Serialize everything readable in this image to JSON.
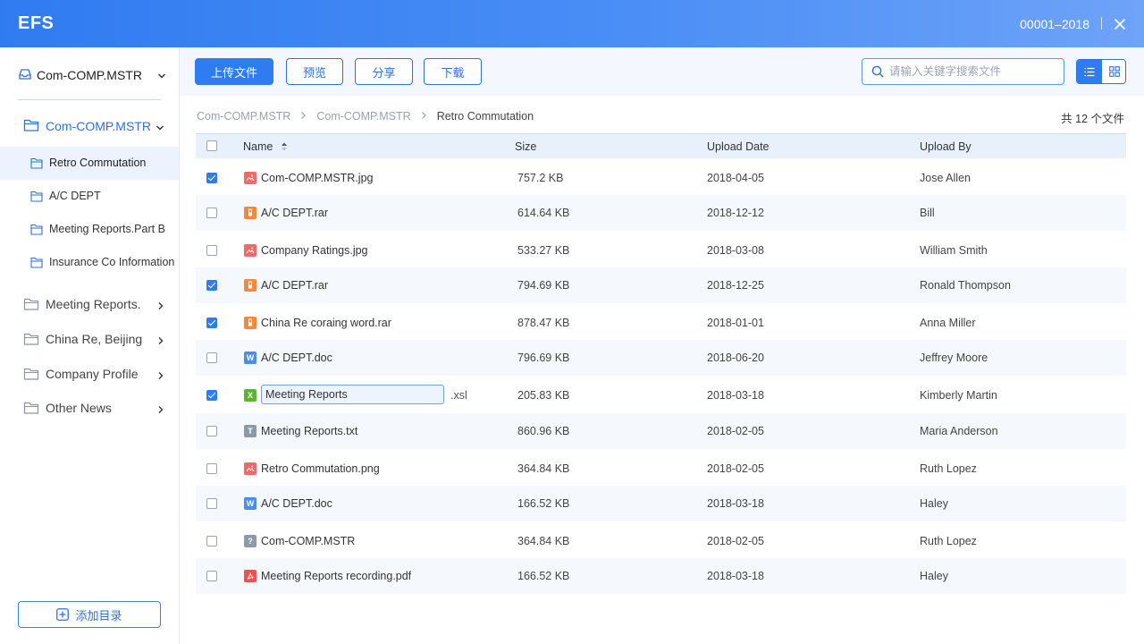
{
  "header": {
    "logo": "EFS",
    "code": "00001–2018"
  },
  "sidebar": {
    "library": "Com-COMP.MSTR",
    "tree_root": "Com-COMP.MSTR",
    "sub_items": [
      {
        "label": "Retro Commutation",
        "active": true
      },
      {
        "label": "A/C DEPT",
        "active": false
      },
      {
        "label": "Meeting Reports.Part B",
        "active": false
      },
      {
        "label": "Insurance Co Information",
        "active": false
      }
    ],
    "folders": [
      {
        "label": "Meeting Reports."
      },
      {
        "label": "China Re, Beijing"
      },
      {
        "label": "Company Profile"
      },
      {
        "label": "Other News"
      }
    ],
    "add_dir_label": "添加目录"
  },
  "toolbar": {
    "upload": "上传文件",
    "preview": "预览",
    "share": "分享",
    "download": "下载",
    "search_placeholder": "请输入关键字搜索文件"
  },
  "breadcrumb": [
    "Com-COMP.MSTR",
    "Com-COMP.MSTR",
    "Retro Commutation"
  ],
  "file_count": "共 12 个文件",
  "table": {
    "columns": {
      "name": "Name",
      "size": "Size",
      "date": "Upload Date",
      "by": "Upload By"
    },
    "rows": [
      {
        "checked": true,
        "type": "image",
        "name": "Com-COMP.MSTR.jpg",
        "size": "757.2 KB",
        "date": "2018-04-05",
        "by": "Jose Allen"
      },
      {
        "checked": false,
        "type": "archive",
        "name": "A/C DEPT.rar",
        "size": "614.64 KB",
        "date": "2018-12-12",
        "by": "Bill"
      },
      {
        "checked": false,
        "type": "image",
        "name": "Company Ratings.jpg",
        "size": "533.27 KB",
        "date": "2018-03-08",
        "by": "William Smith"
      },
      {
        "checked": true,
        "type": "archive",
        "name": "A/C DEPT.rar",
        "size": "794.69 KB",
        "date": "2018-12-25",
        "by": "Ronald Thompson"
      },
      {
        "checked": true,
        "type": "archive",
        "name": "China Re coraing word.rar",
        "size": "878.47 KB",
        "date": "2018-01-01",
        "by": "Anna Miller"
      },
      {
        "checked": false,
        "type": "word",
        "name": "A/C DEPT.doc",
        "size": "796.69 KB",
        "date": "2018-06-20",
        "by": "Jeffrey Moore"
      },
      {
        "checked": true,
        "type": "excel",
        "name": "Meeting Reports",
        "ext": ".xsl",
        "editing": true,
        "size": "205.83 KB",
        "date": "2018-03-18",
        "by": "Kimberly Martin"
      },
      {
        "checked": false,
        "type": "text",
        "name": "Meeting Reports.txt",
        "size": "860.96 KB",
        "date": "2018-02-05",
        "by": "Maria Anderson"
      },
      {
        "checked": false,
        "type": "image",
        "name": "Retro Commutation.png",
        "size": "364.84 KB",
        "date": "2018-02-05",
        "by": "Ruth Lopez"
      },
      {
        "checked": false,
        "type": "word",
        "name": "A/C DEPT.doc",
        "size": "166.52 KB",
        "date": "2018-03-18",
        "by": "Haley"
      },
      {
        "checked": false,
        "type": "unknown",
        "name": "Com-COMP.MSTR",
        "size": "364.84 KB",
        "date": "2018-02-05",
        "by": "Ruth Lopez"
      },
      {
        "checked": false,
        "type": "pdf",
        "name": "Meeting Reports recording.pdf",
        "size": "166.52 KB",
        "date": "2018-03-18",
        "by": "Haley"
      }
    ]
  },
  "file_type_icons": {
    "image": {
      "icon": "image-file-icon",
      "color": "#f06a6a",
      "glyph": ""
    },
    "archive": {
      "icon": "archive-file-icon",
      "color": "#f5883d",
      "glyph": ""
    },
    "word": {
      "icon": "word-file-icon",
      "color": "#4a8ef0",
      "glyph": "W"
    },
    "excel": {
      "icon": "excel-file-icon",
      "color": "#5ab52f",
      "glyph": "X"
    },
    "text": {
      "icon": "text-file-icon",
      "color": "#8f9aa8",
      "glyph": "T"
    },
    "unknown": {
      "icon": "unknown-file-icon",
      "color": "#8f9aa8",
      "glyph": "?"
    },
    "pdf": {
      "icon": "pdf-file-icon",
      "color": "#f05050",
      "glyph": ""
    }
  },
  "colors": {
    "accent": "#2f7bf0",
    "header_start": "#2f7bf0",
    "header_end": "#6ea3f8",
    "row_alt": "#f5f8fc",
    "thead": "#e8f0fc"
  }
}
